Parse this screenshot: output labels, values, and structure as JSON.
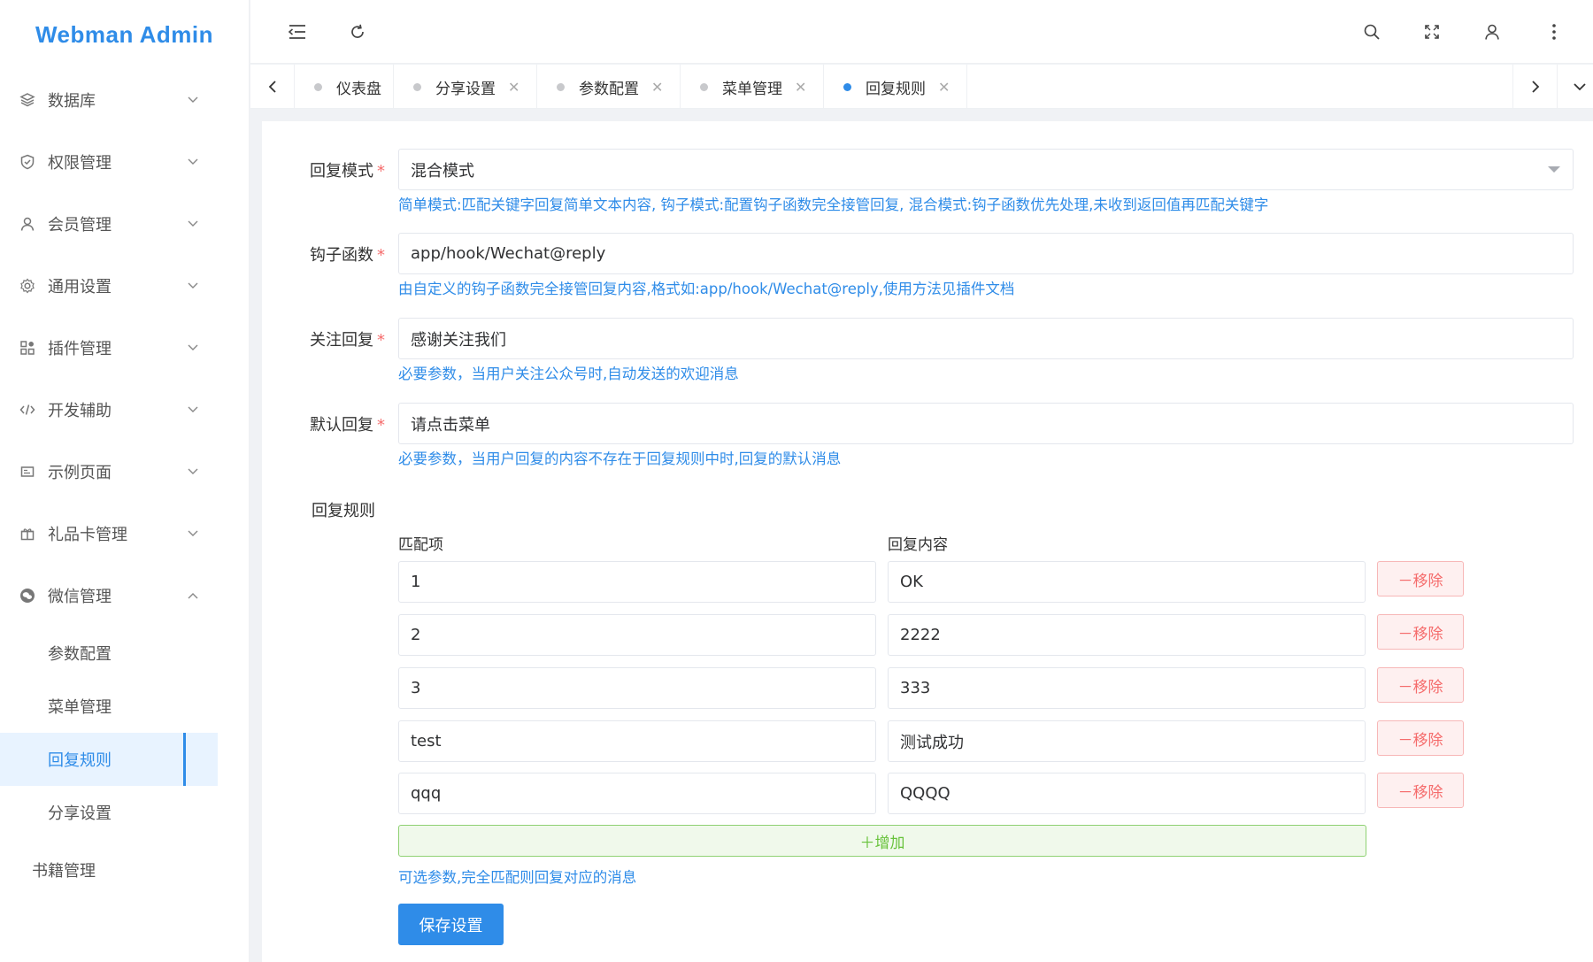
{
  "app": {
    "title": "Webman Admin"
  },
  "sidebar": {
    "items": [
      {
        "label": "数据库",
        "icon": "layers-icon"
      },
      {
        "label": "权限管理",
        "icon": "shield-icon"
      },
      {
        "label": "会员管理",
        "icon": "user-icon"
      },
      {
        "label": "通用设置",
        "icon": "gear-icon"
      },
      {
        "label": "插件管理",
        "icon": "apps-icon"
      },
      {
        "label": "开发辅助",
        "icon": "code-icon"
      },
      {
        "label": "示例页面",
        "icon": "page-icon"
      },
      {
        "label": "礼品卡管理",
        "icon": "gift-icon"
      },
      {
        "label": "微信管理",
        "icon": "wechat-icon"
      }
    ],
    "wechat_sub": [
      {
        "label": "参数配置"
      },
      {
        "label": "菜单管理"
      },
      {
        "label": "回复规则"
      },
      {
        "label": "分享设置"
      }
    ],
    "books": "书籍管理"
  },
  "tabs": [
    {
      "label": "仪表盘"
    },
    {
      "label": "分享设置"
    },
    {
      "label": "参数配置"
    },
    {
      "label": "菜单管理"
    },
    {
      "label": "回复规则"
    }
  ],
  "form": {
    "mode": {
      "label": "回复模式",
      "value": "混合模式",
      "help": "简单模式:匹配关键字回复简单文本内容, 钩子模式:配置钩子函数完全接管回复, 混合模式:钩子函数优先处理,未收到返回值再匹配关键字"
    },
    "hook": {
      "label": "钩子函数",
      "value": "app/hook/Wechat@reply",
      "help": "由自定义的钩子函数完全接管回复内容,格式如:app/hook/Wechat@reply,使用方法见插件文档"
    },
    "follow": {
      "label": "关注回复",
      "value": "感谢关注我们",
      "help": "必要参数，当用户关注公众号时,自动发送的欢迎消息"
    },
    "default": {
      "label": "默认回复",
      "value": "请点击菜单",
      "help": "必要参数，当用户回复的内容不存在于回复规则中时,回复的默认消息"
    },
    "rules": {
      "label": "回复规则",
      "col_match": "匹配项",
      "col_reply": "回复内容",
      "rows": [
        {
          "match": "1",
          "reply": "OK"
        },
        {
          "match": "2",
          "reply": "2222"
        },
        {
          "match": "3",
          "reply": "333"
        },
        {
          "match": "test",
          "reply": "测试成功"
        },
        {
          "match": "qqq",
          "reply": "QQQQ"
        }
      ],
      "remove_label": "－移除",
      "add_label": "＋增加",
      "help": "可选参数,完全匹配则回复对应的消息"
    },
    "save_label": "保存设置"
  },
  "colors": {
    "primary": "#2f8ce8",
    "danger": "#f56c6c",
    "success": "#67c23a"
  }
}
